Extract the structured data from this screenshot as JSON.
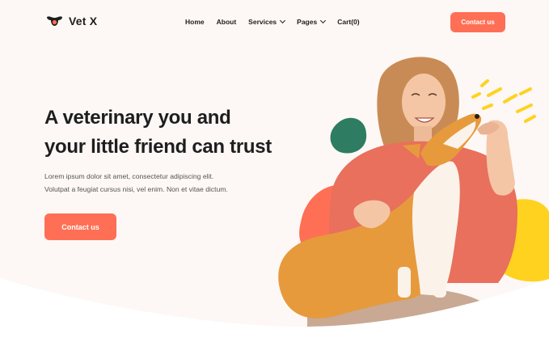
{
  "brand": {
    "name": "Vet X"
  },
  "nav": {
    "items": [
      {
        "label": "Home",
        "has_dropdown": false
      },
      {
        "label": "About",
        "has_dropdown": false
      },
      {
        "label": "Services",
        "has_dropdown": true
      },
      {
        "label": "Pages",
        "has_dropdown": true
      },
      {
        "label": "Cart(0)",
        "has_dropdown": false
      }
    ]
  },
  "header": {
    "contact_label": "Contact us"
  },
  "hero": {
    "title_line1": "A veterinary you and",
    "title_line2": "your little friend can trust",
    "desc_line1": "Lorem ipsum dolor sit amet, consectetur adipiscing elit.",
    "desc_line2": "Volutpat a feugiat cursus nisi, vel enim. Non et vitae dictum.",
    "cta_label": "Contact us"
  },
  "colors": {
    "accent": "#ff6f55",
    "background": "#fdf8f5",
    "text": "#1e1e1e",
    "blob_green": "#2e7d63",
    "blob_yellow": "#ffd21f",
    "blob_coral": "#ff6f55"
  },
  "icons": {
    "logo": "dog-face-icon",
    "dropdown": "chevron-down-icon"
  }
}
